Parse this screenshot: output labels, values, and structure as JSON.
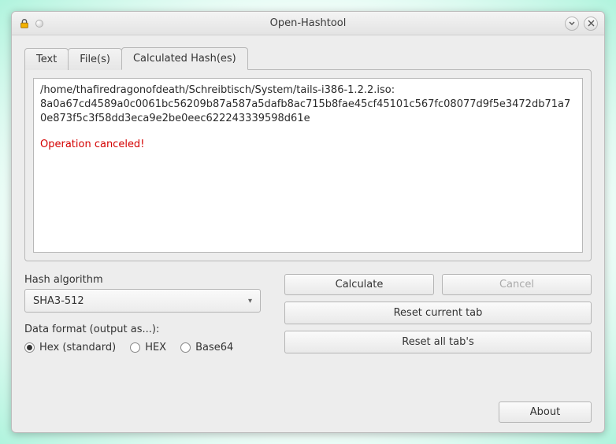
{
  "window": {
    "title": "Open-Hashtool"
  },
  "tabs": {
    "items": [
      {
        "label": "Text"
      },
      {
        "label": "File(s)"
      },
      {
        "label": "Calculated Hash(es)"
      }
    ],
    "active_index": 2
  },
  "output": {
    "file_line": "/home/thafiredragonofdeath/Schreibtisch/System/tails-i386-1.2.2.iso:",
    "hash_line": "8a0a67cd4589a0c0061bc56209b87a587a5dafb8ac715b8fae45cf45101c567fc08077d9f5e3472db71a70e873f5c3f58dd3eca9e2be0eec622243339598d61e",
    "status_line": "Operation canceled!"
  },
  "hash_section": {
    "label": "Hash algorithm",
    "selected": "SHA3-512"
  },
  "format_section": {
    "label": "Data format (output as...):",
    "options": [
      {
        "label": "Hex (standard)",
        "selected": true
      },
      {
        "label": "HEX",
        "selected": false
      },
      {
        "label": "Base64",
        "selected": false
      }
    ]
  },
  "buttons": {
    "calculate": "Calculate",
    "cancel": "Cancel",
    "reset_current": "Reset current tab",
    "reset_all": "Reset all tab's",
    "about": "About"
  }
}
